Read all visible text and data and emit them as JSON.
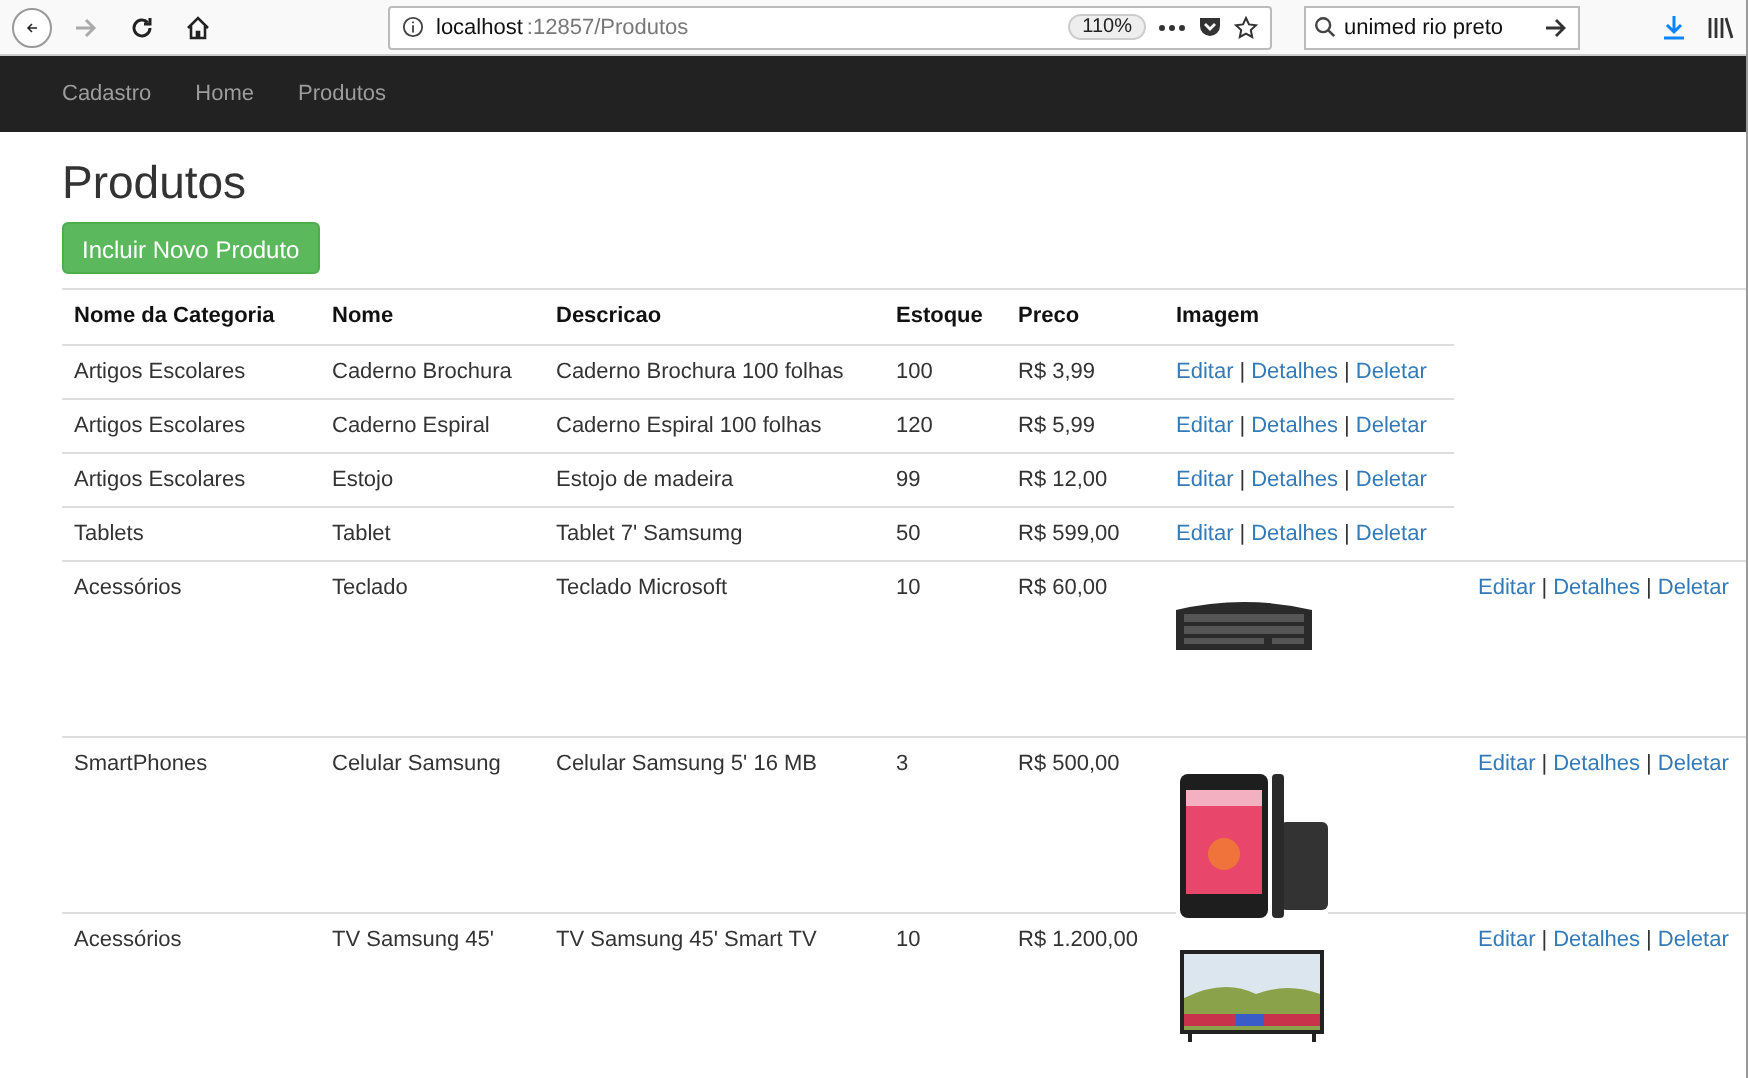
{
  "browser": {
    "url_host": "localhost",
    "url_path": ":12857/Produtos",
    "zoom": "110%",
    "search_value": "unimed rio preto",
    "forward_disabled": true
  },
  "navbar": {
    "brand": "Cadastro",
    "links": [
      {
        "label": "Home"
      },
      {
        "label": "Produtos"
      }
    ]
  },
  "page": {
    "title": "Produtos",
    "create_button": "Incluir Novo Produto"
  },
  "table": {
    "columns": [
      "Nome da Categoria",
      "Nome",
      "Descricao",
      "Estoque",
      "Preco",
      "Imagem"
    ],
    "rows": [
      {
        "category": "Artigos Escolares",
        "name": "Caderno Brochura",
        "description": "Caderno Brochura 100 folhas",
        "stock": "100",
        "price": "R$ 3,99",
        "has_image": false,
        "links": [
          "Editar",
          "Detalhes",
          "Deletar"
        ],
        "separators": [
          "|",
          "|"
        ]
      },
      {
        "category": "Artigos Escolares",
        "name": "Caderno Espiral",
        "description": "Caderno Espiral 100 folhas",
        "stock": "120",
        "price": "R$ 5,99",
        "has_image": false,
        "links": [
          "Editar",
          "Detalhes",
          "Deletar"
        ],
        "separators": [
          "|",
          "|"
        ]
      },
      {
        "category": "Artigos Escolares",
        "name": "Estojo",
        "description": "Estojo de madeira",
        "stock": "99",
        "price": "R$ 12,00",
        "has_image": false,
        "links": [
          "Editar",
          "Detalhes",
          "Deletar"
        ],
        "separators": [
          "|",
          "|"
        ]
      },
      {
        "category": "Tablets",
        "name": "Tablet",
        "description": "Tablet 7' Samsumg",
        "stock": "50",
        "price": "R$ 599,00",
        "has_image": false,
        "links": [
          "Editar",
          "Detalhes",
          "Deletar"
        ],
        "separators": [
          "|",
          "|"
        ]
      },
      {
        "category": "Acessórios",
        "name": "Teclado",
        "description": "Teclado Microsoft",
        "stock": "10",
        "price": "R$ 60,00",
        "has_image": true,
        "image": {
          "kind": "picture"
        },
        "links": [
          "Editar",
          "Detalhes",
          "Deletar"
        ],
        "separators": [
          "|",
          "|"
        ]
      },
      {
        "category": "SmartPhones",
        "name": "Celular Samsung",
        "description": "Celular Samsung 5' 16 MB",
        "stock": "3",
        "price": "R$ 500,00",
        "has_image": true,
        "image": {
          "kind": "picture"
        },
        "links": [
          "Editar",
          "Detalhes",
          "Deletar"
        ],
        "separators": [
          "|",
          "|"
        ]
      },
      {
        "category": "Acessórios",
        "name": "TV Samsung 45'",
        "description": "TV Samsung 45' Smart TV",
        "stock": "10",
        "price": "R$ 1.200,00",
        "has_image": true,
        "image": {
          "kind": "picture"
        },
        "links": [
          "Editar",
          "Detalhes",
          "Deletar"
        ],
        "separators": [
          "|",
          "|"
        ]
      }
    ]
  }
}
